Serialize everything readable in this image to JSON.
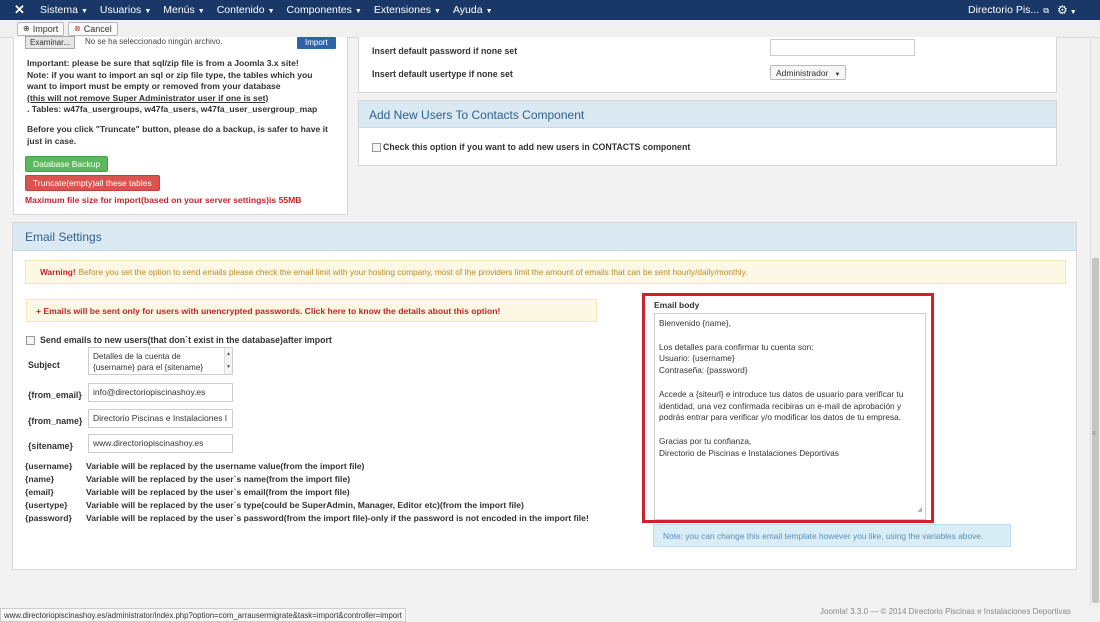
{
  "navbar": {
    "logo_icon": "joomla-icon",
    "menus": [
      "Sistema",
      "Usuarios",
      "Menús",
      "Contenido",
      "Componentes",
      "Extensiones",
      "Ayuda"
    ],
    "site_name": "Directorio Pis...",
    "bg_color": "#1a3867"
  },
  "toolbar": {
    "import_label": "Import",
    "cancel_label": "Cancel"
  },
  "left_panel": {
    "browse_label": "Examinar...",
    "file_status": "No se ha seleccionado ningún archivo.",
    "import_button": "Import",
    "note_line1": "Important: please be sure that sql/zip file is from a Joomla 3.x site!",
    "note_line2": "Note: if you want to import an sql or zip file type, the tables which you",
    "note_line3": "want to import must be empty or removed from your database",
    "note_line4": "(this will not remove Super Administrator user if one is set)",
    "note_line5": ". Tables: w47fa_usergroups, w47fa_users, w47fa_user_usergroup_map",
    "note_line6": "Before you click \"Truncate\" button, please do a backup, is safer to have it",
    "note_line7": "just in case.",
    "backup_button": "Database Backup",
    "truncate_button": "Truncate(empty)all these tables",
    "max_size": "Maximum file size for import(based on your server settings)is 55MB"
  },
  "defaults": {
    "password_label": "Insert default password if none set",
    "password_value": "",
    "usertype_label": "Insert default usertype if none set",
    "usertype_value": "Administrador"
  },
  "contacts": {
    "title": "Add New Users To Contacts Component",
    "checkbox_label": "Check this option if you want to add new users in CONTACTS component"
  },
  "email_settings": {
    "title": "Email Settings",
    "warning_strong": "Warning!",
    "warning_text": "Before you set the option to send emails please check the email limit with your hosting company, most of the providers limit the amount of emails that can be sent hourly/daily/monthly.",
    "unencrypted_note": "+ Emails will be sent only for users with unencrypted passwords. Click here to know the details about this option!",
    "send_checkbox_label": "Send emails to new users(that don`t exist in the database)after import",
    "subject_label": "Subject",
    "subject_line1": "Detalles de la cuenta de",
    "subject_line2": "{username} para el {sitename}",
    "from_email_label": "{from_email}",
    "from_email_value": "info@directoriopiscinashoy.es",
    "from_name_label": "{from_name}",
    "from_name_value": "Directorio Piscinas e Instalaciones I",
    "sitename_label": "{sitename}",
    "sitename_value": "www.directoriopiscinashoy.es",
    "variables": [
      {
        "key": "{username}",
        "desc": "Variable will be replaced by the username value(from the import file)"
      },
      {
        "key": "{name}",
        "desc": "Variable will be replaced by the user`s name(from the import file)"
      },
      {
        "key": "{email}",
        "desc": "Variable will be replaced by the user`s email(from the import file)"
      },
      {
        "key": "{usertype}",
        "desc": "Variable will be replaced by the user`s type(could be SuperAdmin, Manager, Editor etc)(from the import file)"
      },
      {
        "key": "{password}",
        "desc": "Variable will be replaced by the user`s password(from the import file)-only if the password is not encoded in the import file!"
      }
    ],
    "body_label": "Email body",
    "body_lines": [
      "Bienvenido {name},",
      "",
      "Los detalles para confirmar tu cuenta son:",
      "Usuario: {username}",
      "Contraseña: {password}",
      "",
      "Accede a {siteurl} e introduce tus datos de usuario para verificar tu",
      "identidad, una vez confirmada recibiras un e-mail de aprobación y",
      "podrás entrar para verificar y/o modificar los datos de tu empresa.",
      "",
      "Gracias por tu confianza,",
      "Directorio de Piscinas e Instalaciones Deportivas"
    ],
    "template_note": "Note: you can change this email template however you like, using the variables above.",
    "highlight_color": "#d0202a"
  },
  "footer": {
    "status_url": "www.directoriopiscinashoy.es/administrator/index.php?option=com_arrausermigrate&task=import&controller=import",
    "copyright": "Joomla! 3.3.0  — © 2014 Directorio Piscinas e Instalaciones Deportivas"
  }
}
